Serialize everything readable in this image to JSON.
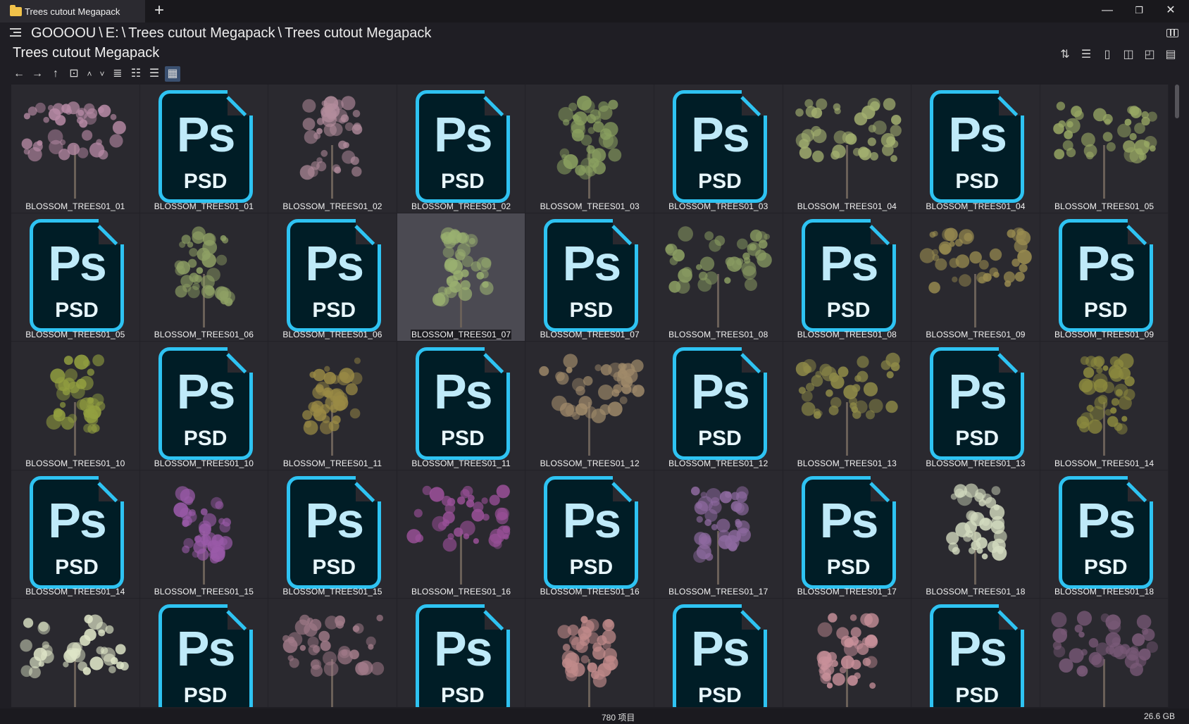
{
  "window": {
    "tab_title": "Trees cutout Megapack",
    "new_tab": "+",
    "minimize": "—",
    "restore": "❐",
    "close": "✕"
  },
  "address": {
    "segments": [
      "GOOOOU",
      "E:",
      "Trees cutout Megapack",
      "Trees cutout Megapack"
    ],
    "separator": "\\"
  },
  "folder_title": "Trees cutout Megapack",
  "right_tools": [
    "sort-icon",
    "details-icon",
    "file-icon",
    "preview-icon",
    "thumbnail-icon",
    "clipboard-icon"
  ],
  "nav": {
    "back": "←",
    "forward": "→",
    "up": "↑",
    "browse": "⊡",
    "expand": "˄",
    "collapse": "˅",
    "views": [
      "≣",
      "☷",
      "☰",
      "▦"
    ]
  },
  "items": [
    {
      "name": "BLOSSOM_TREES01_01",
      "type": "tree",
      "color": "#b78aa5"
    },
    {
      "name": "BLOSSOM_TREES01_01",
      "type": "psd"
    },
    {
      "name": "BLOSSOM_TREES01_02",
      "type": "tree",
      "color": "#b28c9c"
    },
    {
      "name": "BLOSSOM_TREES01_02",
      "type": "psd"
    },
    {
      "name": "BLOSSOM_TREES01_03",
      "type": "tree",
      "color": "#8aa060"
    },
    {
      "name": "BLOSSOM_TREES01_03",
      "type": "psd"
    },
    {
      "name": "BLOSSOM_TREES01_04",
      "type": "tree",
      "color": "#a3b070"
    },
    {
      "name": "BLOSSOM_TREES01_04",
      "type": "psd"
    },
    {
      "name": "BLOSSOM_TREES01_05",
      "type": "tree",
      "color": "#98a864"
    },
    {
      "name": "BLOSSOM_TREES01_05",
      "type": "psd"
    },
    {
      "name": "BLOSSOM_TREES01_06",
      "type": "tree",
      "color": "#8ea064"
    },
    {
      "name": "BLOSSOM_TREES01_06",
      "type": "psd"
    },
    {
      "name": "BLOSSOM_TREES01_07",
      "type": "tree",
      "color": "#9ab070",
      "selected": true
    },
    {
      "name": "BLOSSOM_TREES01_07",
      "type": "psd"
    },
    {
      "name": "BLOSSOM_TREES01_08",
      "type": "tree",
      "color": "#8a9c62"
    },
    {
      "name": "BLOSSOM_TREES01_08",
      "type": "psd"
    },
    {
      "name": "BLOSSOM_TREES01_09",
      "type": "tree",
      "color": "#9a8c50"
    },
    {
      "name": "BLOSSOM_TREES01_09",
      "type": "psd"
    },
    {
      "name": "BLOSSOM_TREES01_10",
      "type": "tree",
      "color": "#93a040"
    },
    {
      "name": "BLOSSOM_TREES01_10",
      "type": "psd"
    },
    {
      "name": "BLOSSOM_TREES01_11",
      "type": "tree",
      "color": "#9a8a45"
    },
    {
      "name": "BLOSSOM_TREES01_11",
      "type": "psd"
    },
    {
      "name": "BLOSSOM_TREES01_12",
      "type": "tree",
      "color": "#a08a6a"
    },
    {
      "name": "BLOSSOM_TREES01_12",
      "type": "psd"
    },
    {
      "name": "BLOSSOM_TREES01_13",
      "type": "tree",
      "color": "#8e8a48"
    },
    {
      "name": "BLOSSOM_TREES01_13",
      "type": "psd"
    },
    {
      "name": "BLOSSOM_TREES01_14",
      "type": "tree",
      "color": "#8c8a3e"
    },
    {
      "name": "BLOSSOM_TREES01_14",
      "type": "psd"
    },
    {
      "name": "BLOSSOM_TREES01_15",
      "type": "tree",
      "color": "#9a5aa8"
    },
    {
      "name": "BLOSSOM_TREES01_15",
      "type": "psd"
    },
    {
      "name": "BLOSSOM_TREES01_16",
      "type": "tree",
      "color": "#9a5098"
    },
    {
      "name": "BLOSSOM_TREES01_16",
      "type": "psd"
    },
    {
      "name": "BLOSSOM_TREES01_17",
      "type": "tree",
      "color": "#8e6aa0"
    },
    {
      "name": "BLOSSOM_TREES01_17",
      "type": "psd"
    },
    {
      "name": "BLOSSOM_TREES01_18",
      "type": "tree",
      "color": "#d4dcc0"
    },
    {
      "name": "BLOSSOM_TREES01_18",
      "type": "psd"
    },
    {
      "name": "",
      "type": "tree",
      "color": "#dfe6c8"
    },
    {
      "name": "",
      "type": "psd"
    },
    {
      "name": "",
      "type": "tree",
      "color": "#a07a88"
    },
    {
      "name": "",
      "type": "psd"
    },
    {
      "name": "",
      "type": "tree",
      "color": "#c08a8a"
    },
    {
      "name": "",
      "type": "psd"
    },
    {
      "name": "",
      "type": "tree",
      "color": "#c8909a"
    },
    {
      "name": "",
      "type": "psd"
    },
    {
      "name": "",
      "type": "tree",
      "color": "#7a5a78"
    }
  ],
  "psd_icon": {
    "logo": "Ps",
    "label": "PSD"
  },
  "status": {
    "count": "780 项目",
    "size": "26.6 GB"
  }
}
